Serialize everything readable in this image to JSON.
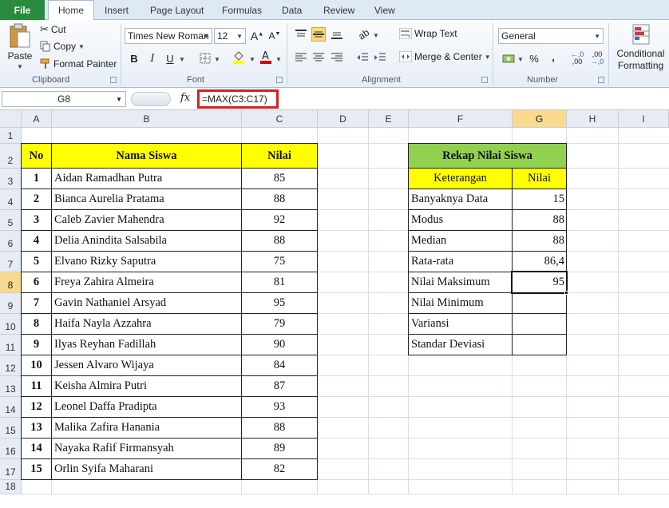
{
  "tabs": {
    "file": "File",
    "items": [
      "Home",
      "Insert",
      "Page Layout",
      "Formulas",
      "Data",
      "Review",
      "View"
    ]
  },
  "ribbon": {
    "clipboard": {
      "paste": "Paste",
      "cut": "Cut",
      "copy": "Copy",
      "format_painter": "Format Painter",
      "label": "Clipboard"
    },
    "font": {
      "name": "Times New Roman",
      "size": "12",
      "bold": "B",
      "italic": "I",
      "underline": "U",
      "label": "Font"
    },
    "alignment": {
      "wrap_text": "Wrap Text",
      "merge_center": "Merge & Center",
      "label": "Alignment"
    },
    "number": {
      "format": "General",
      "percent": "%",
      "comma": ",",
      "inc_decimal": ",00",
      "dec_decimal": ",0",
      "label": "Number"
    },
    "styles": {
      "conditional": "Conditional",
      "formatting": "Formatting"
    }
  },
  "formula_bar": {
    "name_box": "G8",
    "fx": "fx",
    "formula": "=MAX(C3:C17)"
  },
  "colors": {
    "header_yellow": "#ffff00",
    "header_green": "#92d050",
    "formula_highlight": "#d32222",
    "file_tab": "#2a8a3e"
  },
  "columns": [
    "A",
    "B",
    "C",
    "D",
    "E",
    "F",
    "G",
    "H",
    "I"
  ],
  "rows": [
    "1",
    "2",
    "3",
    "4",
    "5",
    "6",
    "7",
    "8",
    "9",
    "10",
    "11",
    "12",
    "13",
    "14",
    "15",
    "16",
    "17",
    "18"
  ],
  "students": {
    "header": {
      "no": "No",
      "name": "Nama Siswa",
      "score": "Nilai"
    },
    "rows": [
      {
        "no": "1",
        "name": "Aidan Ramadhan Putra",
        "score": "85"
      },
      {
        "no": "2",
        "name": "Bianca Aurelia Pratama",
        "score": "88"
      },
      {
        "no": "3",
        "name": "Caleb Zavier Mahendra",
        "score": "92"
      },
      {
        "no": "4",
        "name": "Delia Anindita Salsabila",
        "score": "88"
      },
      {
        "no": "5",
        "name": "Elvano Rizky Saputra",
        "score": "75"
      },
      {
        "no": "6",
        "name": "Freya Zahira Almeira",
        "score": "81"
      },
      {
        "no": "7",
        "name": "Gavin Nathaniel Arsyad",
        "score": "95"
      },
      {
        "no": "8",
        "name": "Haifa Nayla Azzahra",
        "score": "79"
      },
      {
        "no": "9",
        "name": "Ilyas Reyhan Fadillah",
        "score": "90"
      },
      {
        "no": "10",
        "name": "Jessen Alvaro Wijaya",
        "score": "84"
      },
      {
        "no": "11",
        "name": "Keisha Almira Putri",
        "score": "87"
      },
      {
        "no": "12",
        "name": "Leonel Daffa Pradipta",
        "score": "93"
      },
      {
        "no": "13",
        "name": "Malika Zafira Hanania",
        "score": "88"
      },
      {
        "no": "14",
        "name": "Nayaka Rafif Firmansyah",
        "score": "89"
      },
      {
        "no": "15",
        "name": "Orlin Syifa Maharani",
        "score": "82"
      }
    ]
  },
  "summary": {
    "title": "Rekap Nilai Siswa",
    "header": {
      "desc": "Keterangan",
      "value": "Nilai"
    },
    "rows": [
      {
        "label": "Banyaknya Data",
        "value": "15"
      },
      {
        "label": "Modus",
        "value": "88"
      },
      {
        "label": "Median",
        "value": "88"
      },
      {
        "label": "Rata-rata",
        "value": "86,4"
      },
      {
        "label": "Nilai Maksimum",
        "value": "95"
      },
      {
        "label": "Nilai Minimum",
        "value": ""
      },
      {
        "label": "Variansi",
        "value": ""
      },
      {
        "label": "Standar Deviasi",
        "value": ""
      }
    ]
  }
}
